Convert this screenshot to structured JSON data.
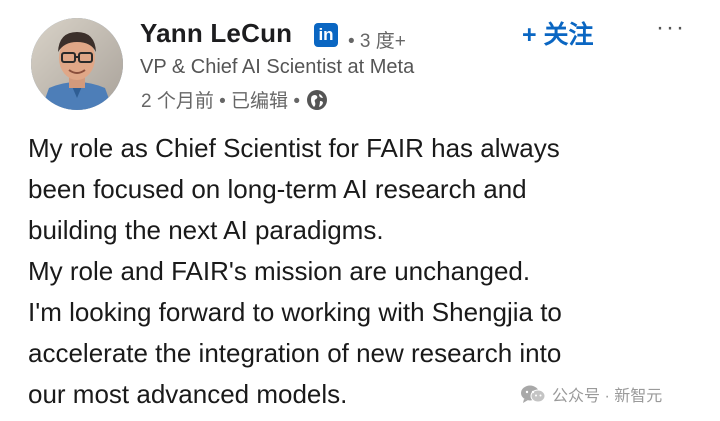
{
  "author": {
    "name": "Yann LeCun",
    "linkedin_badge": "in",
    "degree": "• 3 度+",
    "headline": "VP & Chief AI Scientist at Meta",
    "meta": "2 个月前 • 已编辑 •"
  },
  "actions": {
    "follow_label": "+ 关注",
    "more_label": "···"
  },
  "post": {
    "lines": [
      "My role as Chief Scientist for FAIR has always",
      "been focused on long-term AI research and",
      "building the next AI paradigms.",
      "My role and FAIR's mission are unchanged.",
      "I'm looking forward to working with Shengjia to",
      "accelerate the integration of new research into",
      "our most advanced models."
    ]
  },
  "watermark": {
    "text": "公众号 · 新智元"
  },
  "icons": {
    "globe": "globe-icon",
    "linkedin": "linkedin-icon",
    "wechat": "wechat-icon",
    "more": "more-horizontal-icon"
  },
  "colors": {
    "link_blue": "#0a66c2",
    "text_primary": "#1a1a1a",
    "text_secondary": "#666666"
  }
}
